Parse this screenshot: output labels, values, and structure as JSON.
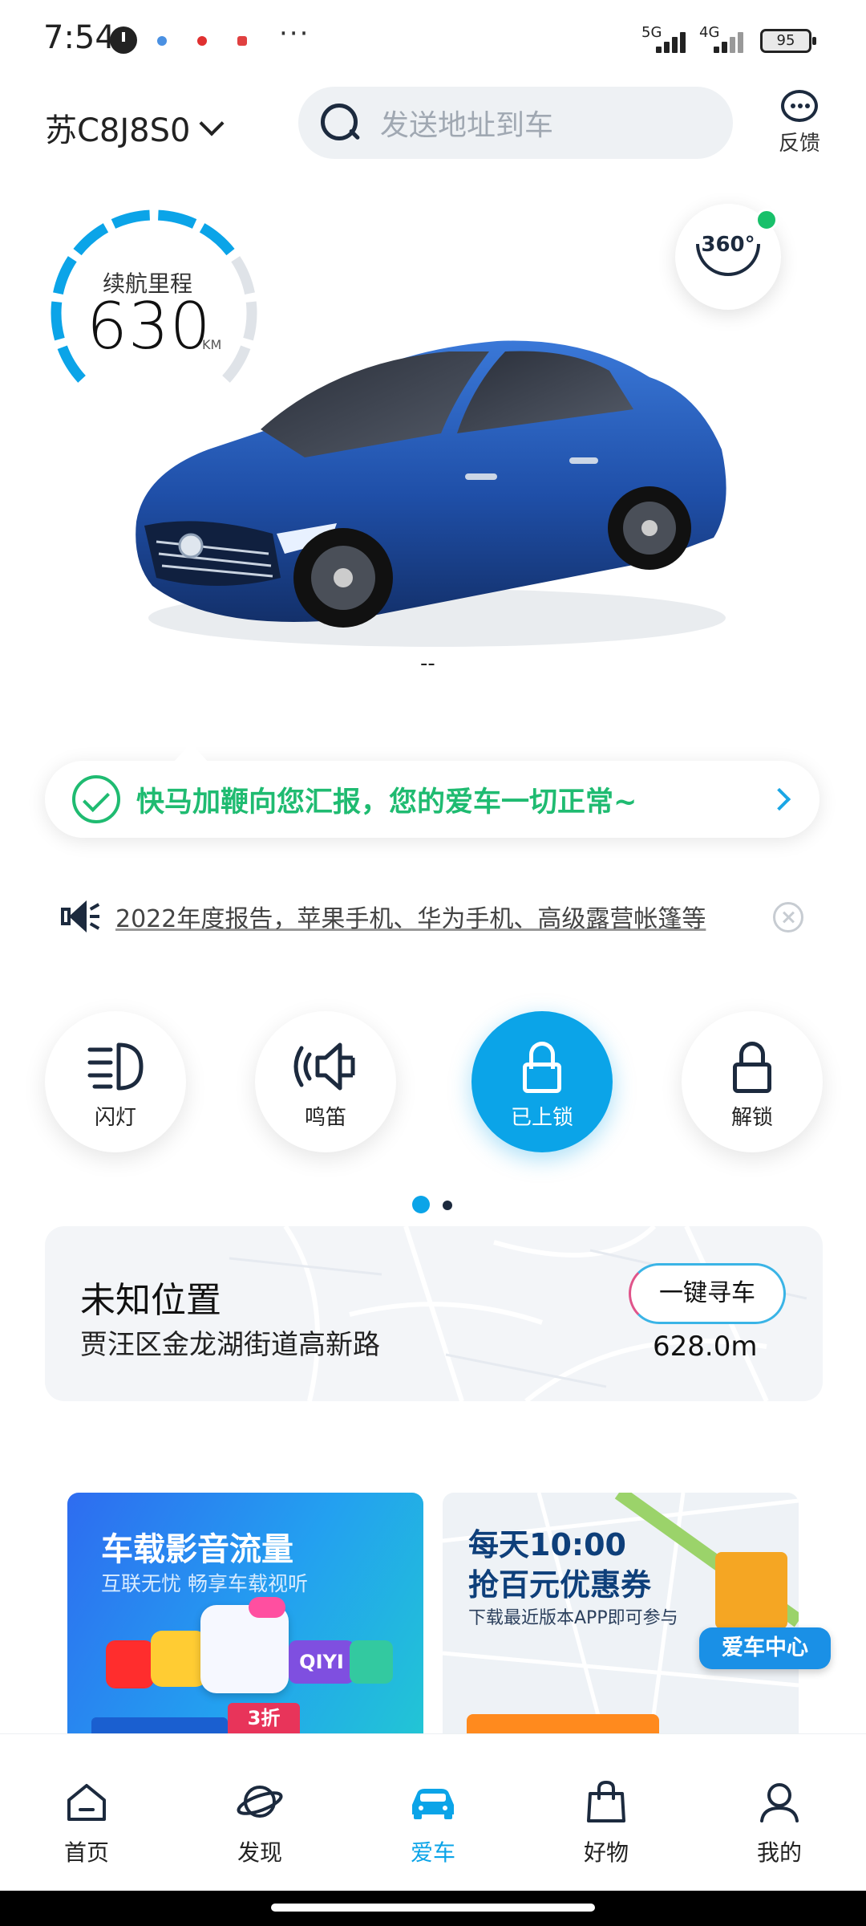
{
  "status_bar": {
    "time": "7:54",
    "network1": "5G",
    "network2": "4G",
    "battery": "95"
  },
  "header": {
    "plate": "苏C8J8S0",
    "search_placeholder": "发送地址到车",
    "feedback_label": "反馈"
  },
  "gauge": {
    "title": "续航里程",
    "value": "630",
    "unit": "KM",
    "level": 0.72
  },
  "view360": {
    "label": "360°"
  },
  "car": {
    "status_dash": "--"
  },
  "status_bubble": {
    "text": "快马加鞭向您汇报，您的爱车一切正常~"
  },
  "notice": {
    "text": "2022年度报告，苹果手机、华为手机、高级露营帐篷等"
  },
  "controls": [
    {
      "label": "闪灯",
      "icon": "headlight-icon",
      "active": false
    },
    {
      "label": "鸣笛",
      "icon": "horn-icon",
      "active": false
    },
    {
      "label": "已上锁",
      "icon": "lock-closed-icon",
      "active": true
    },
    {
      "label": "解锁",
      "icon": "lock-open-icon",
      "active": false
    }
  ],
  "location": {
    "title": "未知位置",
    "address": "贾汪区金龙湖街道高新路",
    "find_button": "一键寻车",
    "distance": "628.0m"
  },
  "promos": {
    "left": {
      "title": "车载影音流量",
      "subtitle": "互联无忧  畅享车载视听",
      "badge": "3折",
      "app_text": "QIYI"
    },
    "right": {
      "title_line1": "每天10:00",
      "title_line2": "抢百元优惠券",
      "subtitle": "下载最近版本APP即可参与",
      "tag": "爱车中心"
    }
  },
  "bottom_nav": [
    {
      "label": "首页",
      "active": false
    },
    {
      "label": "发现",
      "active": false
    },
    {
      "label": "爱车",
      "active": true
    },
    {
      "label": "好物",
      "active": false
    },
    {
      "label": "我的",
      "active": false
    }
  ],
  "colors": {
    "accent": "#0ba4e8",
    "ok_green": "#1fbb71",
    "dark": "#1c2a3e"
  }
}
